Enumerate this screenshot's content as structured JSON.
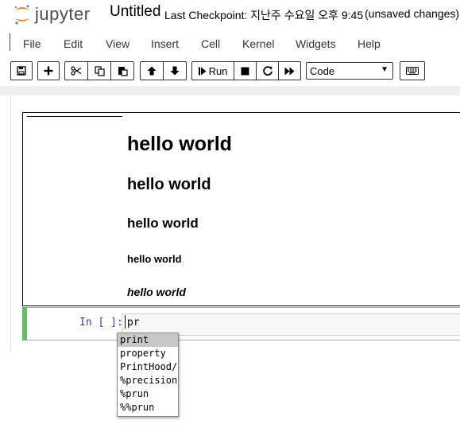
{
  "header": {
    "logo_text": "jupyter",
    "notebook_name": "Untitled",
    "checkpoint": "Last Checkpoint: 지난주 수요일 오후 9:45",
    "save_status": "(unsaved changes)"
  },
  "menu": [
    "File",
    "Edit",
    "View",
    "Insert",
    "Cell",
    "Kernel",
    "Widgets",
    "Help"
  ],
  "toolbar": {
    "run_label": "Run",
    "cell_type": "Code",
    "icons": [
      "save-icon",
      "plus-icon",
      "cut-icon",
      "copy-icon",
      "paste-icon",
      "arrow-up-icon",
      "arrow-down-icon",
      "step-icon",
      "stop-icon",
      "restart-icon",
      "fast-forward-icon",
      "keyboard-icon"
    ]
  },
  "markdown_cell": {
    "h1": "hello world",
    "h2": "hello world",
    "h3": "hello world",
    "h4": "hello world",
    "h5": "hello world"
  },
  "code_cell": {
    "prompt": "In [ ]:",
    "input": "pr"
  },
  "completer": {
    "selected_index": 0,
    "items": [
      "print",
      "property",
      "PrintHood/",
      "%precision",
      "%prun",
      "%%prun"
    ]
  },
  "colors": {
    "edit_mode_bar": "#66bb6a",
    "prompt": "#303f9f",
    "logo_orange": "#f37726"
  }
}
